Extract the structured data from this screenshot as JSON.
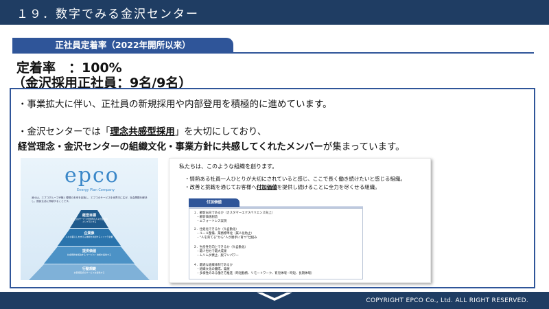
{
  "header": {
    "title": "１９．数字でみる金沢センター"
  },
  "section": {
    "tab_label": "正社員定着率（2022年開所以来）"
  },
  "stats": {
    "rate_label": "定着率　：100%",
    "hires_label": "（金沢採用正社員：9名/9名）"
  },
  "body": {
    "line1": "・事業拡大に伴い、正社員の新規採用や内部登用を積極的に進めています。",
    "line2_pre": "・金沢センターでは「",
    "line2_kw": "理念共感型採用",
    "line2_post": "」を大切にしており、",
    "line3_bold": "経営理念・金沢センターの組織文化・事業方針に共感してくれたメンバー",
    "line3_tail": "が集まっています。"
  },
  "pyramid": {
    "logo": "epco",
    "logo_sub": "Energy Plan Company",
    "intro": "我々は、エプコグループが築く理想の未来を目指し、エプコのサービスを世界中に広げ、社会問題を解決し、国民生活に貢献することです。",
    "layers": [
      {
        "title": "経営目標",
        "sub": "エプコのサービスを世界の人々の生活のインフラにする"
      },
      {
        "title": "企業像",
        "sub": "人々の暮らしを支える技術を共創するインフラ企業"
      },
      {
        "title": "提供価値",
        "sub": "社会問題を解決する サービス・技術を提供する"
      },
      {
        "title": "行動規範",
        "sub": "お客様起点のサービスを提供する"
      }
    ]
  },
  "culture": {
    "heading": "私たちは、このような組織を創ります。",
    "bullet1": "・情熱ある社員一人ひとりが大切にされていると感じ、ここで長く働き続けたいと感じる組織。",
    "bullet2_pre": "・改善と挑戦を通じてお客様へ",
    "bullet2_kw": "付加価値",
    "bullet2_post": "を提供し続けることに全力を尽くせる組織。",
    "values_tab": "付加価値",
    "values": [
      "１．顧客志向であるか（カスタマーエクスペリエンス向上）",
      "　・顧客価値創造",
      "　・エフォートレス実現",
      "２．仕組化できるか（％自動化）",
      "　・ルール整備、業務標準化（属人化防止）",
      "　・“人を育てる”から“人が勝手に育つ”仕組み",
      "３．生産性を向上できるか（％自動化）",
      "　・最少労力で最大成果",
      "　・ムリムダ撲止、脱マンパワー",
      "４．最適な組織体制であるか",
      "　・組織文化の醸成、発展",
      "　・多様性のある働き方推進（時短勤務、リモートワーク、育児休暇・時短、長期休暇）"
    ]
  },
  "footer": {
    "copyright": "COPYRIGHT EPCO Co., Ltd. ALL RIGHT RESERVED."
  }
}
